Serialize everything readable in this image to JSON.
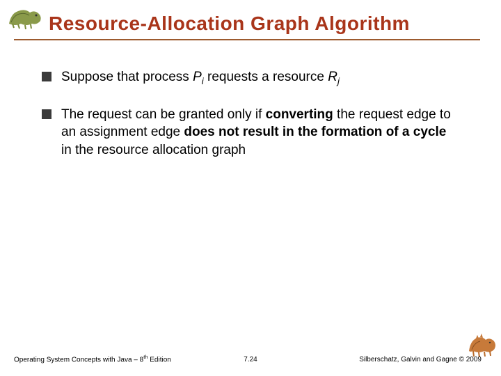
{
  "title": "Resource-Allocation Graph Algorithm",
  "bullets": {
    "b1": {
      "pre": "Suppose that process ",
      "p": "P",
      "psub": "i",
      "mid": " requests a resource ",
      "r": "R",
      "rsub": "j"
    },
    "b2": {
      "t1": "The request can be granted only if ",
      "t2": "converting",
      "t3": " the request edge to an assignment edge ",
      "t4": "does not result in the formation of a cycle",
      "t5": " in the resource allocation graph"
    }
  },
  "footer": {
    "left_a": "Operating System Concepts  with Java – 8",
    "left_sup": "th",
    "left_b": " Edition",
    "center": "7.24",
    "right": "Silberschatz, Galvin and Gagne © 2009"
  }
}
